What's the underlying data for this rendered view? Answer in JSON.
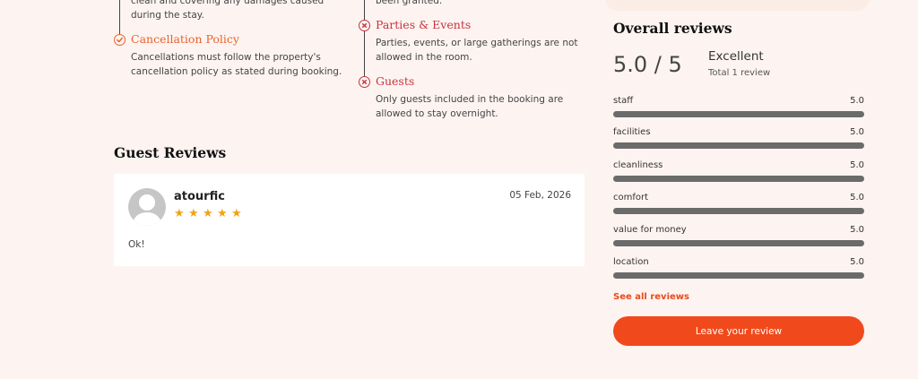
{
  "policies": {
    "left": {
      "top_text": "clean and covering any damages caused during the stay.",
      "cancellation": {
        "title": "Cancellation Policy",
        "text": "Cancellations must follow the property's cancellation policy as stated during booking.",
        "icon": "check-circle-icon",
        "color": "#e9622b"
      }
    },
    "right": {
      "top_text": "been granted.",
      "parties": {
        "title": "Parties & Events",
        "text": "Parties, events, or large gatherings are not allowed in the room.",
        "icon": "x-circle-icon",
        "color": "#c8323e"
      },
      "guests": {
        "title": "Guests",
        "text": "Only guests included in the booking are allowed to stay overnight.",
        "icon": "x-circle-icon",
        "color": "#c8323e"
      }
    }
  },
  "guest_reviews": {
    "heading": "Guest Reviews",
    "items": [
      {
        "name": "atourfic",
        "date": "05 Feb, 2026",
        "rating": 5,
        "text": "Ok!"
      }
    ]
  },
  "overall": {
    "heading": "Overall reviews",
    "score": "5.0 / 5",
    "rating_word": "Excellent",
    "total": "Total 1 review",
    "categories": [
      {
        "label": "staff",
        "value": "5.0",
        "fraction": 1.0
      },
      {
        "label": "facilities",
        "value": "5.0",
        "fraction": 1.0
      },
      {
        "label": "cleanliness",
        "value": "5.0",
        "fraction": 1.0
      },
      {
        "label": "comfort",
        "value": "5.0",
        "fraction": 1.0
      },
      {
        "label": "value for money",
        "value": "5.0",
        "fraction": 1.0
      },
      {
        "label": "location",
        "value": "5.0",
        "fraction": 1.0
      }
    ],
    "see_all": "See all reviews",
    "leave_review": "Leave your review"
  },
  "colors": {
    "accent": "#f04a1c",
    "star": "#f0a317",
    "bar": "#6b6b6b",
    "background": "#fdf4f1"
  }
}
